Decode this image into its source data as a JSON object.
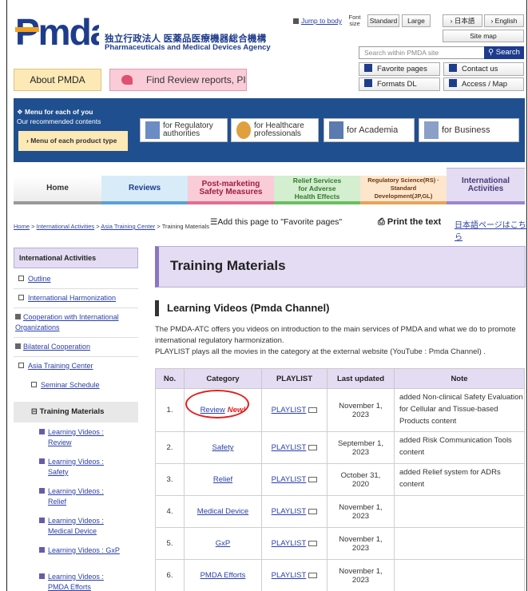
{
  "header": {
    "logo_text": "Pmda",
    "agency_jp": "独立行政法人 医薬品医療機器総合機構",
    "agency_en": "Pharmaceuticals and Medical Devices Agency",
    "jump_link": "Jump to body",
    "font_size_label": "Font size",
    "font_standard": "Standard",
    "font_large": "Large",
    "lang_jp": "› 日本語",
    "lang_en": "› English",
    "sitemap": "Site map",
    "search_placeholder": "Search within PMDA site",
    "search_button": "Search",
    "favorite_pages": "Favorite pages",
    "contact_us": "Contact us",
    "formats_dl": "Formats DL",
    "access_map": "Access / Map",
    "about_pmda": "About PMDA",
    "find_review": "Find Review reports, PI"
  },
  "menu": {
    "title": "Menu for each of you",
    "subtitle": "Our recommended contents",
    "product_type": "Menu of each product type",
    "audiences": [
      {
        "l1": "for Regulatory",
        "l2": "authorities"
      },
      {
        "l1": "for Healthcare",
        "l2": "professionals"
      },
      {
        "l1": "for Academia",
        "l2": ""
      },
      {
        "l1": "for Business",
        "l2": ""
      }
    ]
  },
  "tabs": {
    "home": "Home",
    "reviews": "Reviews",
    "post1": "Post-marketing",
    "post2": "Safety Measures",
    "relief1": "Relief Services",
    "relief2": "for Adverse",
    "relief3": "Health Effects",
    "rs1": "Regulatory Science(RS) ·",
    "rs2": "Standard",
    "rs3": "Development(JP,GL)",
    "intl1": "International",
    "intl2": "Activities"
  },
  "breadcrumb": {
    "home": "Home",
    "intl": "International Activities",
    "atc": "Asia Training Center",
    "current": "Training Materials",
    "sep": ">"
  },
  "page_tools": {
    "add_favorite": "Add this page to \"Favorite pages\"",
    "print": "Print the text",
    "jp_page": "日本語ページはこちら"
  },
  "sidebar": {
    "heading": "International Activities",
    "items": [
      {
        "label": "Outline"
      },
      {
        "label": "International Harmonization"
      },
      {
        "label": "Cooperation with International Organizations"
      },
      {
        "label": "Bilateral Cooperation"
      },
      {
        "label": "Asia Training Center"
      },
      {
        "label": "Seminar Schedule"
      }
    ],
    "selected": "Training Materials",
    "subitems": [
      {
        "l1": "Learning Videos :",
        "l2": "Review"
      },
      {
        "l1": "Learning Videos :",
        "l2": "Safety"
      },
      {
        "l1": "Learning Videos :",
        "l2": "Relief"
      },
      {
        "l1": "Learning Videos :",
        "l2": "Medical Device"
      },
      {
        "l1": "Learning Videos : GxP",
        "l2": ""
      },
      {
        "l1": "Learning Videos :",
        "l2": "PMDA Efforts"
      }
    ]
  },
  "main": {
    "title": "Training Materials",
    "subheading": "Learning Videos (Pmda Channel)",
    "intro1": "The PMDA-ATC offers you videos on introduction to the main services of PMDA and what we do to promote international regulatory harmonization.",
    "intro2": "PLAYLIST plays all the movies in the category at the external website (YouTube : Pmda Channel) .",
    "new_tag": "New!",
    "table": {
      "headers": [
        "No.",
        "Category",
        "PLAYLIST",
        "Last updated",
        "Note"
      ],
      "rows": [
        {
          "no": "1.",
          "category": "Review",
          "playlist": "PLAYLIST",
          "updated1": "November 1,",
          "updated2": "2023",
          "note": "added Non-clinical Safety Evaluation for Cellular and Tissue-based Products  content"
        },
        {
          "no": "2.",
          "category": "Safety",
          "playlist": "PLAYLIST",
          "updated1": "September 1,",
          "updated2": "2023",
          "note": "added Risk Communication Tools content"
        },
        {
          "no": "3.",
          "category": "Relief",
          "playlist": "PLAYLIST",
          "updated1": "October 31,",
          "updated2": "2020",
          "note": "added Relief system for ADRs content"
        },
        {
          "no": "4.",
          "category": "Medical Device",
          "playlist": "PLAYLIST",
          "updated1": "November 1,",
          "updated2": "2023",
          "note": ""
        },
        {
          "no": "5.",
          "category": "GxP",
          "playlist": "PLAYLIST",
          "updated1": "November 1,",
          "updated2": "2023",
          "note": ""
        },
        {
          "no": "6.",
          "category": "PMDA Efforts",
          "playlist": "PLAYLIST",
          "updated1": "November 1,",
          "updated2": "2023",
          "note": ""
        }
      ]
    }
  },
  "colors": {
    "brand_blue": "#1e3c8c",
    "menu_blue": "#1f4f8f",
    "accent_purple": "#e3dcf2",
    "highlight_red": "#e02020"
  }
}
